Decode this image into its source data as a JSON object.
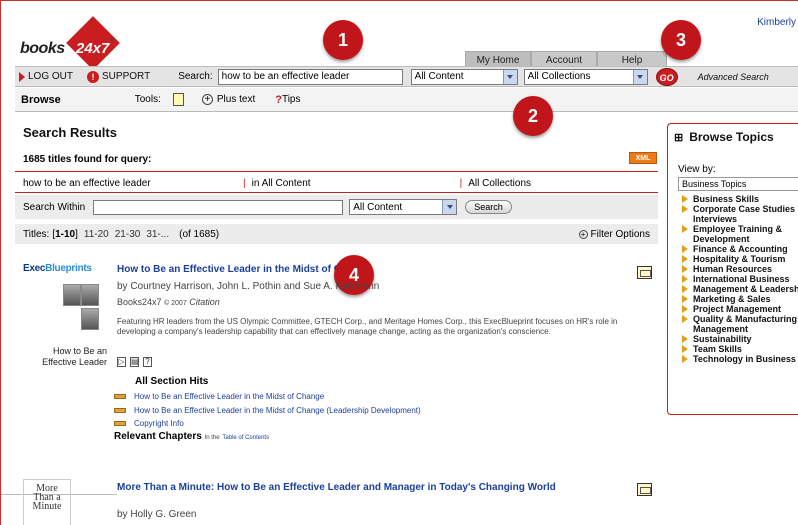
{
  "user": "Kimberly",
  "logo": {
    "text": "books",
    "num": "24x7",
    "reg": "®"
  },
  "topnav": {
    "home": "My Home",
    "account": "Account Info",
    "help": "Help"
  },
  "toolbar": {
    "logout": "LOG OUT",
    "support": "SUPPORT",
    "search_label": "Search:",
    "search_value": "how to be an effective leader",
    "content_select": "All Content",
    "collections_select": "All Collections",
    "go": "GO",
    "advanced": "Advanced Search"
  },
  "browse": {
    "label": "Browse",
    "tools": "Tools:",
    "plus_text": "Plus text",
    "tips": "Tips"
  },
  "badges": [
    "1",
    "2",
    "3",
    "4"
  ],
  "results": {
    "title": "Search Results",
    "found": "1685 titles found for query:",
    "xml": "XML",
    "query": "how to be an effective leader",
    "in_content": "in All Content",
    "in_collections": "All Collections",
    "search_within": "Search Within",
    "within_select": "All Content",
    "search_btn": "Search",
    "titles_label": "Titles:",
    "page_current": "1-10",
    "pages": [
      "11-20",
      "21-30",
      "31-..."
    ],
    "total": "(of 1685)",
    "filter": "Filter Options"
  },
  "entry1": {
    "cover_brand_a": "Exec",
    "cover_brand_b": "Blueprints",
    "cover_caption_1": "How to Be an",
    "cover_caption_2": "Effective Leader",
    "title": "How to Be an Effective Leader in the Midst of Change",
    "authors": "by Courtney Harrison, John L. Pothin and Sue A. Karrmann",
    "publisher": "Books24x7",
    "year": "© 2007",
    "series": "Citation",
    "description": "Featuring HR leaders from the US Olympic Committee, GTECH Corp., and Meritage Homes Corp., this ExecBlueprint focuses on HR's role in developing a company's leadership capability that can effectively manage change, acting as the organization's conscience.",
    "hits_head": "All Section Hits",
    "hits": [
      "How to Be an Effective Leader in the Midst of Change",
      "How to Be an Effective Leader in the Midst of Change (Leadership Development)",
      "Copyright Info"
    ],
    "relevant": "Relevant Chapters",
    "relevant_in": "In the",
    "relevant_link": "Table of Contents"
  },
  "entry2": {
    "cover": [
      "More",
      "Than a",
      "Minute"
    ],
    "title": "More Than a Minute: How to Be an Effective Leader and Manager in Today's Changing World",
    "authors": "by Holly G. Green"
  },
  "topics": {
    "title": "Browse Topics",
    "view_by": "View by:",
    "selected": "Business Topics",
    "items": [
      "Business Skills",
      "Corporate Case Studies",
      "Interviews",
      "Employee Training &",
      "Development",
      "Finance & Accounting",
      "Hospitality & Tourism",
      "Human Resources",
      "International Business",
      "Management & Leadership",
      "Marketing & Sales",
      "Project Management",
      "Quality & Manufacturing",
      "Management",
      "Sustainability",
      "Team Skills",
      "Technology in Business"
    ]
  }
}
